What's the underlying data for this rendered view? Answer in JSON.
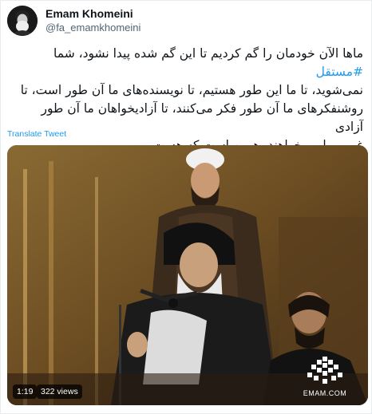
{
  "author": {
    "display_name": "Emam Khomeini",
    "handle": "@fa_emamkhomeini",
    "avatar_icon": "profile-photo"
  },
  "tweet": {
    "line1": "ماها الآن خودمان را گم کردیم تا این گم شده پیدا نشود، شما ",
    "hashtag": "#مستقل",
    "line2": "نمی‌شوید، تا ما این طور هستیم، تا نویسنده‌های ما آن طور است، تا",
    "line3": "روشنفکرهای ما آن طور فکر می‌کنند، تا آزادیخواهان ما آن طور آزادی",
    "line4": "غربی را می‌خواهند، همین است که هست."
  },
  "translate_label": "Translate Tweet",
  "video": {
    "duration": "1:19",
    "views": "322 views",
    "watermark": "EMAM.COM"
  },
  "colors": {
    "accent": "#1d9bf0",
    "text": "#0f1419",
    "secondary": "#536471"
  }
}
